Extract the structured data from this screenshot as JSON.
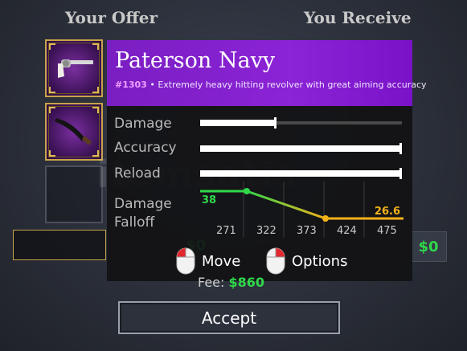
{
  "headers": {
    "your_offer": "Your Offer",
    "you_receive": "You Receive"
  },
  "offer": {
    "money": "$0"
  },
  "receive": {
    "money": "$0"
  },
  "tooltip": {
    "title": "Paterson Navy",
    "item_number": "#1303",
    "description": "Extremely heavy hitting revolver with great aiming accuracy",
    "stats": [
      {
        "label": "Damage",
        "value": 0.38
      },
      {
        "label": "Accuracy",
        "value": 1.0
      },
      {
        "label": "Reload",
        "value": 1.0
      }
    ],
    "falloff": {
      "label_line1": "Damage",
      "label_line2": "Falloff",
      "start_value": "38",
      "end_value": "26.6",
      "ticks": [
        "271",
        "322",
        "373",
        "424",
        "475"
      ]
    },
    "controls": {
      "move": "Move",
      "options": "Options"
    }
  },
  "fee": {
    "label": "Fee:",
    "amount": "$860"
  },
  "accept_label": "Accept",
  "watermark": "itemsatis",
  "colors": {
    "rarity_purple": "#8b23d6",
    "money_green": "#2fd84a",
    "falloff_orange": "#f3b21a",
    "gold_border": "#c9a24a"
  },
  "icons": {
    "slot_1": "revolver-icon",
    "slot_2": "knife-icon",
    "mouse_left": "mouse-left-click-icon",
    "mouse_right": "mouse-right-click-icon"
  }
}
